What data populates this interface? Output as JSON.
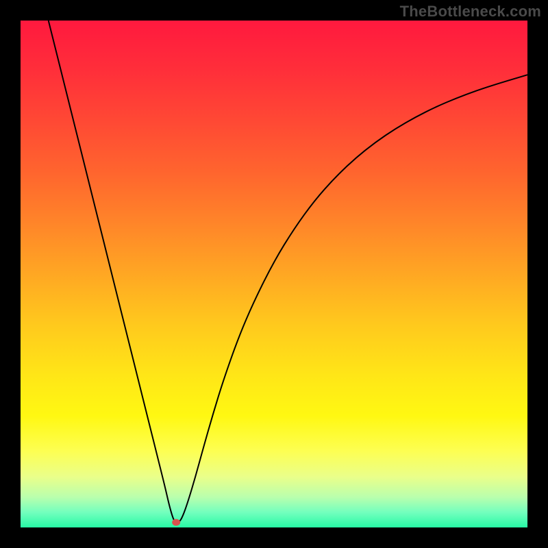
{
  "watermark": "TheBottleneck.com",
  "chart_data": {
    "type": "line",
    "title": "",
    "xlabel": "",
    "ylabel": "",
    "xlim": [
      0,
      100
    ],
    "ylim": [
      0,
      100
    ],
    "grid": false,
    "legend": false,
    "background_gradient_stops": [
      {
        "offset": 0.0,
        "color": "#ff193e"
      },
      {
        "offset": 0.1,
        "color": "#ff2f3a"
      },
      {
        "offset": 0.2,
        "color": "#ff4934"
      },
      {
        "offset": 0.3,
        "color": "#ff652e"
      },
      {
        "offset": 0.4,
        "color": "#ff8529"
      },
      {
        "offset": 0.5,
        "color": "#ffa723"
      },
      {
        "offset": 0.6,
        "color": "#ffc91d"
      },
      {
        "offset": 0.7,
        "color": "#ffe617"
      },
      {
        "offset": 0.78,
        "color": "#fff812"
      },
      {
        "offset": 0.85,
        "color": "#fdff53"
      },
      {
        "offset": 0.9,
        "color": "#eaff8a"
      },
      {
        "offset": 0.94,
        "color": "#baffad"
      },
      {
        "offset": 0.97,
        "color": "#73ffbe"
      },
      {
        "offset": 1.0,
        "color": "#27f9a5"
      }
    ],
    "series": [
      {
        "name": "bottleneck-curve",
        "type": "line",
        "color": "#000000",
        "stroke_width": 2,
        "x": [
          5.5,
          7,
          9,
          11,
          13,
          15,
          17,
          19,
          21,
          23,
          25,
          27,
          28.5,
          29.3,
          30.0,
          30.5,
          31.3,
          32.0,
          33.0,
          34.5,
          36,
          38,
          40,
          43,
          46,
          50,
          54,
          58,
          62,
          66,
          70,
          74,
          78,
          82,
          86,
          90,
          94,
          98,
          100
        ],
        "y": [
          100,
          94,
          86,
          78,
          70,
          62,
          54,
          46,
          38,
          30,
          22,
          14,
          8,
          4.5,
          2.0,
          1.0,
          1.0,
          2.2,
          5.0,
          10.0,
          15.5,
          22.5,
          29.0,
          37.5,
          44.5,
          52.5,
          59.0,
          64.5,
          69.0,
          72.8,
          76.0,
          78.7,
          81.0,
          83.0,
          84.7,
          86.2,
          87.5,
          88.7,
          89.3
        ]
      }
    ],
    "marker": {
      "name": "optimal-point",
      "x": 30.7,
      "y": 1.0,
      "color": "#d8544e",
      "rx": 6,
      "ry": 5
    }
  }
}
